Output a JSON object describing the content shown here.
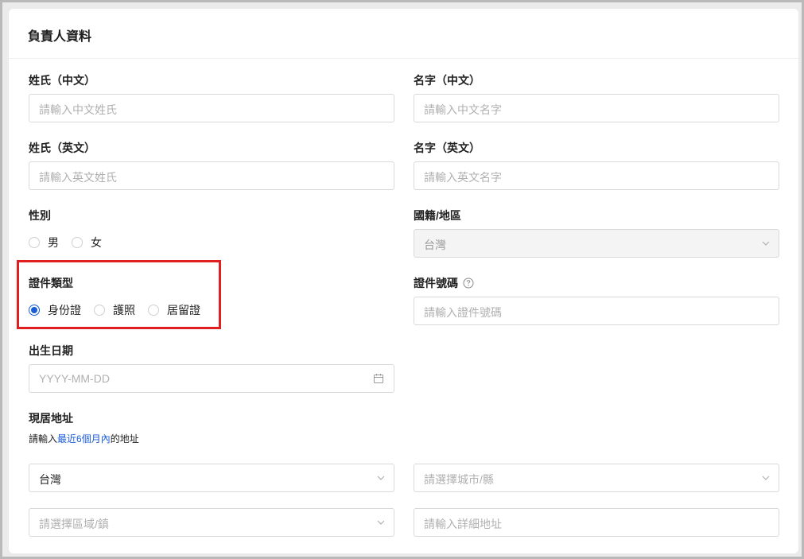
{
  "section": {
    "title": "負責人資料"
  },
  "fields": {
    "last_name_zh": {
      "label": "姓氏（中文）",
      "placeholder": "請輸入中文姓氏"
    },
    "first_name_zh": {
      "label": "名字（中文）",
      "placeholder": "請輸入中文名字"
    },
    "last_name_en": {
      "label": "姓氏（英文）",
      "placeholder": "請輸入英文姓氏"
    },
    "first_name_en": {
      "label": "名字（英文）",
      "placeholder": "請輸入英文名字"
    },
    "gender": {
      "label": "性別",
      "options": [
        "男",
        "女"
      ],
      "selected": null
    },
    "nationality": {
      "label": "國籍/地區",
      "value": "台灣",
      "disabled": true
    },
    "id_type": {
      "label": "證件類型",
      "options": [
        "身份證",
        "護照",
        "居留證"
      ],
      "selected": "身份證"
    },
    "id_number": {
      "label": "證件號碼",
      "placeholder": "請輸入證件號碼",
      "help_icon": "question-circle-icon"
    },
    "birth_date": {
      "label": "出生日期",
      "placeholder": "YYYY-MM-DD",
      "icon": "calendar-icon"
    },
    "address": {
      "label": "現居地址",
      "hint_prefix": "請輸入",
      "hint_link": "最近6個月內",
      "hint_suffix": "的地址",
      "country": {
        "value": "台灣"
      },
      "city": {
        "placeholder": "請選擇城市/縣"
      },
      "district": {
        "placeholder": "請選擇區域/鎮"
      },
      "detail": {
        "placeholder": "請輸入詳細地址"
      }
    }
  },
  "colors": {
    "accent": "#1a5cd6",
    "highlight": "#e02020",
    "border": "#d9d9d9"
  }
}
